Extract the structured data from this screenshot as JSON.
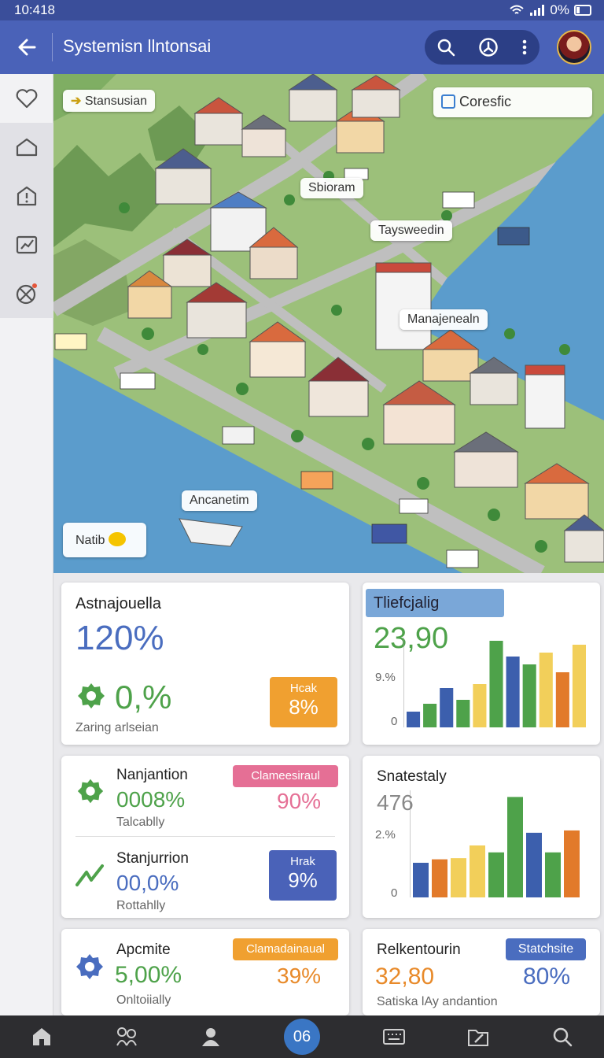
{
  "status": {
    "time": "10:418",
    "battery": "0%"
  },
  "header": {
    "title": "Systemisn llntonsai"
  },
  "map": {
    "labels": {
      "stansusian": "Stansusian",
      "coresfic": "Coresfic",
      "sbioram": "Sbioram",
      "taysweedin": "Taysweedin",
      "manajenealn": "Manajenealn",
      "ancanetim": "Ancanetim",
      "natib": "Natib"
    }
  },
  "cards": {
    "card1": {
      "title": "Astnajouella",
      "big": "120%",
      "value": "0,%",
      "subtitle": "Zaring arlseian",
      "badge_label": "Hcak",
      "badge_value": "8%"
    },
    "chart1": {
      "title": "Tliefcjalig",
      "big": "23,90",
      "tick_mid": "9.%",
      "tick_zero": "0"
    },
    "card2": {
      "row1": {
        "title": "Nanjantion",
        "value": "0008%",
        "subtitle": "Talcablly",
        "badge": "Clameesiraul",
        "pct": "90%"
      },
      "row2": {
        "title": "Stanjurrion",
        "value": "00,0%",
        "subtitle": "Rottahlly",
        "badge_label": "Hrak",
        "badge_value": "9%"
      }
    },
    "chart2": {
      "title": "Snatestaly",
      "big": "476",
      "tick_mid": "2.%",
      "tick_zero": "0"
    },
    "card3": {
      "title": "Apcmite",
      "value": "5,00%",
      "subtitle": "Onltoiially",
      "badge": "Clamadainaual",
      "pct": "39%"
    },
    "card4": {
      "title": "Relkentourin",
      "value": "32,80",
      "badge": "Statchsite",
      "pct": "80%",
      "subtitle": "Satiska lAy andantion"
    }
  },
  "chart_data": [
    {
      "type": "bar",
      "values": [
        2,
        3,
        5,
        3.5,
        5.5,
        11,
        9,
        8,
        9.5,
        7,
        10.5
      ],
      "colors": [
        "#3c5fad",
        "#4ea24a",
        "#3c5fad",
        "#4ea24a",
        "#f2cf5a",
        "#4ea24a",
        "#3c5fad",
        "#4ea24a",
        "#f2cf5a",
        "#e27a2a",
        "#f2cf5a"
      ],
      "ylim": [
        0,
        11
      ]
    },
    {
      "type": "bar",
      "values": [
        3,
        3.3,
        3.4,
        4.5,
        3.9,
        8.7,
        5.6,
        3.9,
        5.8
      ],
      "colors": [
        "#3c5fad",
        "#e27a2a",
        "#f2cf5a",
        "#f2cf5a",
        "#4ea24a",
        "#4ea24a",
        "#3c5fad",
        "#4ea24a",
        "#e27a2a"
      ],
      "ylim": [
        0,
        9
      ]
    }
  ],
  "nav": {
    "center_label": "06"
  },
  "colors": {
    "appbar": "#4a62b8",
    "accent_blue": "#3c5fad",
    "accent_green": "#4ea24a",
    "accent_orange": "#f0a030",
    "accent_pink": "#e56f95"
  },
  "icons": [
    "heart-icon",
    "home-icon",
    "alert-house-icon",
    "chart-icon",
    "settings-icon",
    "search-icon",
    "compass-icon",
    "more-icon",
    "arrow-icon",
    "gear-icon",
    "trend-icon"
  ]
}
